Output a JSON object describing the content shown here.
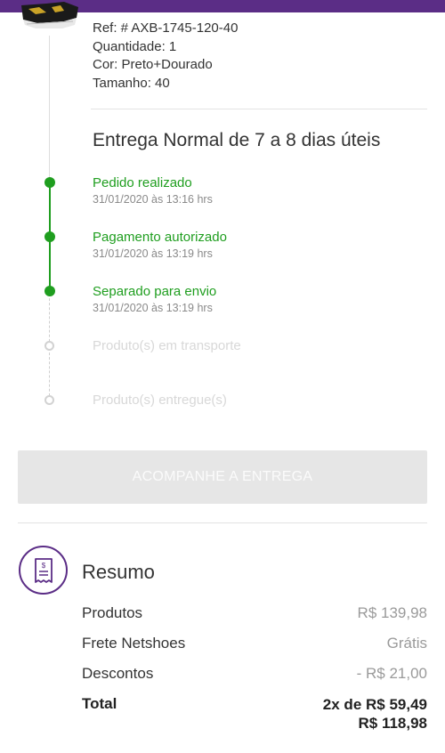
{
  "colors": {
    "brand": "#5b2d86",
    "success": "#1f9e1f",
    "pending": "#d2d2d2",
    "button_disabled": "#e6e6e6"
  },
  "product": {
    "ref": "Ref: # AXB-1745-120-40",
    "quantity": "Quantidade: 1",
    "color": "Cor: Preto+Dourado",
    "size": "Tamanho: 40"
  },
  "delivery": {
    "title": "Entrega Normal de 7 a 8 dias úteis",
    "steps": [
      {
        "label": "Pedido realizado",
        "time": "31/01/2020 às 13:16 hrs",
        "status": "done"
      },
      {
        "label": "Pagamento autorizado",
        "time": "31/01/2020 às 13:19 hrs",
        "status": "done"
      },
      {
        "label": "Separado para envio",
        "time": "31/01/2020 às 13:19 hrs",
        "status": "done"
      },
      {
        "label": "Produto(s) em transporte",
        "time": "",
        "status": "pending"
      },
      {
        "label": "Produto(s) entregue(s)",
        "time": "",
        "status": "pending"
      }
    ]
  },
  "track_button": {
    "label": "ACOMPANHE A ENTREGA",
    "enabled": false
  },
  "summary": {
    "icon": "receipt-icon",
    "title": "Resumo",
    "rows": [
      {
        "label": "Produtos",
        "value": "R$ 139,98"
      },
      {
        "label": "Frete Netshoes",
        "value": "Grátis"
      },
      {
        "label": "Descontos",
        "value": "- R$ 21,00"
      }
    ],
    "total": {
      "label": "Total",
      "installments": "2x de R$ 59,49",
      "value": "R$ 118,98"
    }
  }
}
